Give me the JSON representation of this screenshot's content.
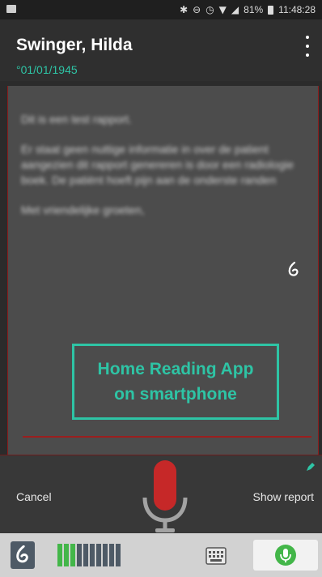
{
  "status_bar": {
    "battery": "81%",
    "time": "11:48:28",
    "icons": [
      "image-icon",
      "bluetooth-icon",
      "do-not-disturb-icon",
      "alarm-icon",
      "wifi-icon",
      "signal-icon",
      "battery-icon"
    ]
  },
  "header": {
    "patient_name": "Swinger, Hilda",
    "birth_date": "°01/01/1945",
    "menu_icon": "more-vertical-icon"
  },
  "report": {
    "paragraphs": [
      "Dit is een test rapport.",
      "Er staat geen nuttige informatie in over de patient aangezien dit rapport genereren is door een radiologie boek. De patiënt hoeft pijn aan de onderste randen",
      "Met vriendelijke groeten,"
    ],
    "icon": "dragon-icon"
  },
  "watermark": {
    "line1": "Home Reading App",
    "line2": "on smartphone"
  },
  "controls": {
    "cancel_label": "Cancel",
    "show_report_label": "Show report",
    "mic_icon": "microphone-icon",
    "edit_icon": "pencil-icon"
  },
  "bottom_bar": {
    "dragon_icon": "dragon-icon",
    "audio_level_icon": "audio-level-meter",
    "audio_level": 0.3,
    "keyboard_icon": "keyboard-icon",
    "mic_button_icon": "microphone-icon"
  },
  "colors": {
    "accent": "#2ec4a5",
    "mic_red": "#c62828",
    "record_green": "#43b649",
    "border_red": "#8a1d1d"
  }
}
